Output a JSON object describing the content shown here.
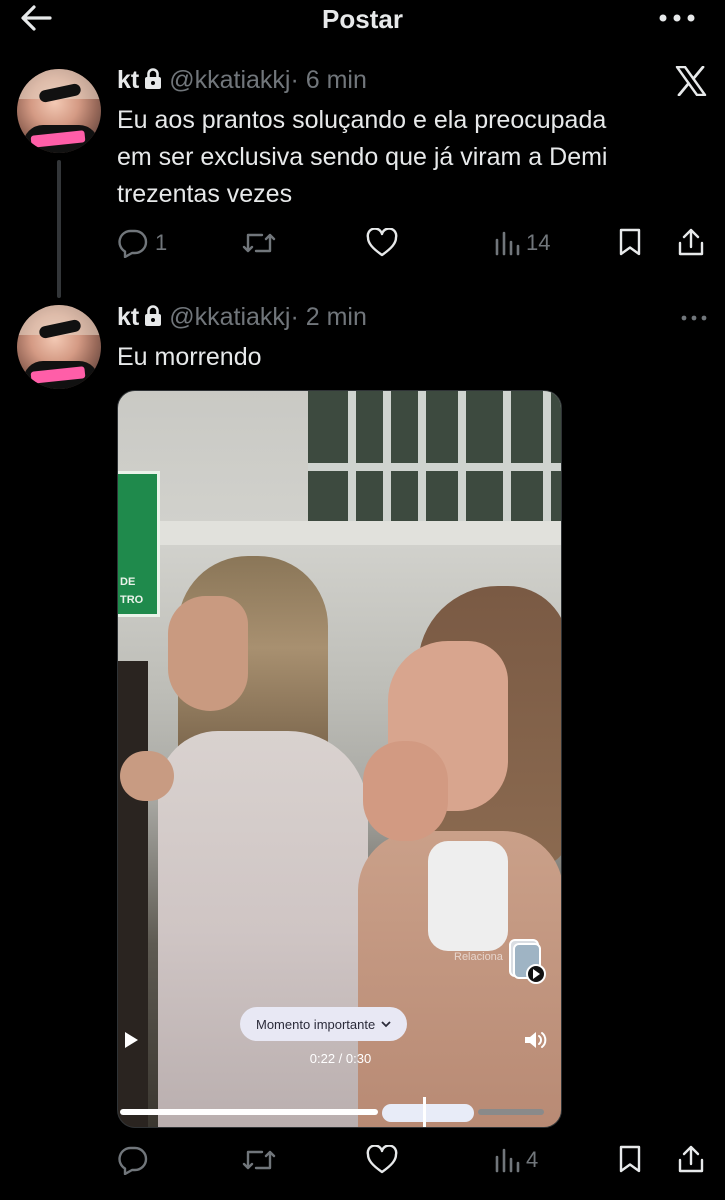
{
  "header": {
    "title": "Postar"
  },
  "tweets": [
    {
      "name": "kt",
      "handle": "@kkatiakkj",
      "time": "· 6 min",
      "text_lines": [
        "Eu aos prantos soluçando e ela preocupada",
        "em ser exclusiva sendo que já viram a Demi",
        "trezentas vezes"
      ],
      "replies": "1",
      "views": "14"
    },
    {
      "name": "kt",
      "handle": "@kkatiakkj",
      "time": "· 2 min",
      "text_lines": [
        "Eu morrendo"
      ],
      "views": "4",
      "video": {
        "sign_text_1": "DE",
        "sign_text_2": "TRO",
        "related_label": "Relaciona",
        "moment_label": "Momento importante",
        "time_display": "0:22 / 0:30",
        "progress": 0.73
      }
    }
  ],
  "colors": {
    "background": "#000000",
    "text": "#e7e9ea",
    "muted": "#71767b"
  }
}
